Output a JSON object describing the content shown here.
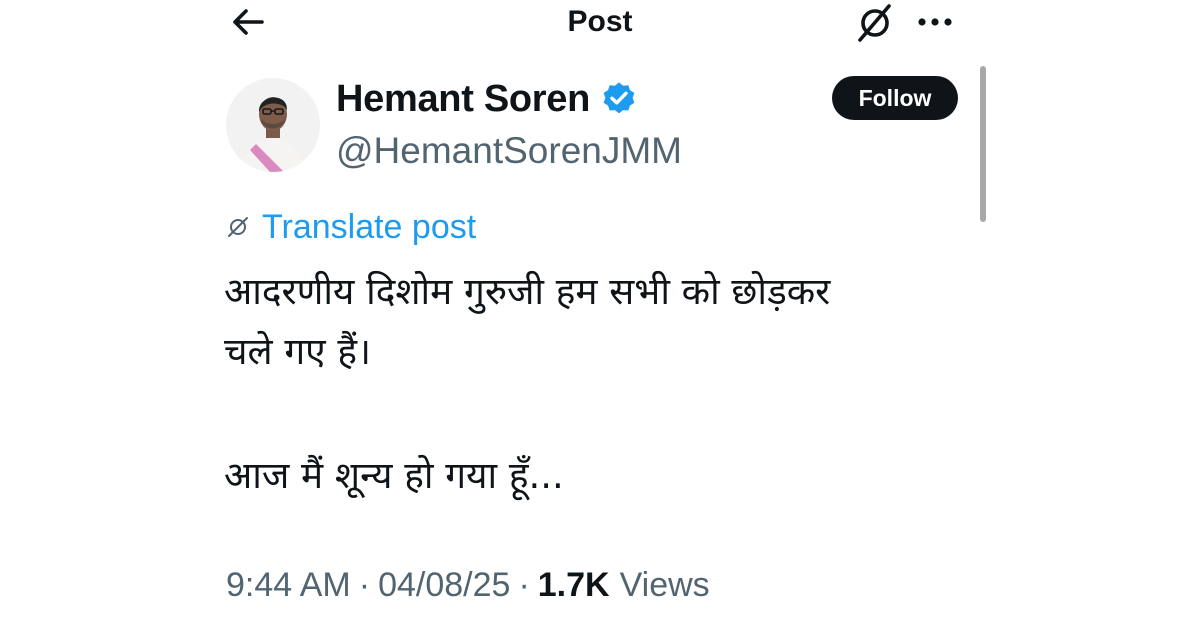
{
  "header": {
    "title": "Post",
    "back_icon": "arrow-left-icon",
    "grok_icon": "grok-icon",
    "more_icon": "more-horizontal-icon"
  },
  "author": {
    "display_name": "Hemant Soren",
    "handle": "@HemantSorenJMM",
    "verified": true,
    "verified_color": "#1d9bf0"
  },
  "follow_button": {
    "label": "Follow"
  },
  "translate": {
    "label": "Translate post",
    "color": "#1d9bf0"
  },
  "post": {
    "lines": [
      "आदरणीय दिशोम गुरुजी हम सभी को छोड़कर",
      "चले गए हैं।",
      "आज मैं शून्य हो गया हूँ..."
    ]
  },
  "meta": {
    "time": "9:44 AM",
    "separator": "·",
    "date": "04/08/25",
    "views_count": "1.7K",
    "views_label": "Views"
  },
  "colors": {
    "text_primary": "#0f1419",
    "text_secondary": "#536471",
    "accent": "#1d9bf0"
  }
}
